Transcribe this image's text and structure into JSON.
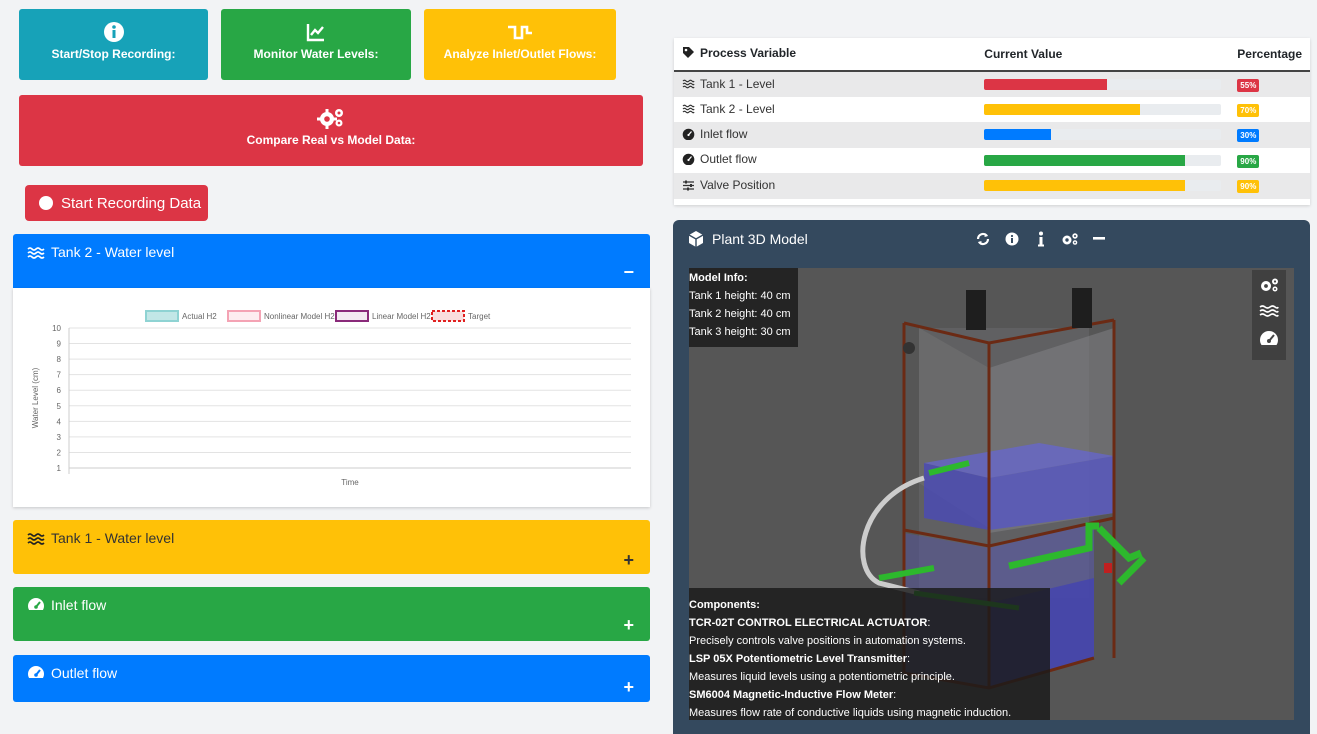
{
  "actions": {
    "start_stop": "Start/Stop Recording:",
    "monitor": "Monitor Water Levels:",
    "analyze": "Analyze Inlet/Outlet Flows:",
    "compare": "Compare Real vs Model Data:"
  },
  "record_button": "Start Recording Data",
  "panels": {
    "tank2": {
      "title": "Tank 2 - Water level",
      "toggle": "−"
    },
    "tank1": {
      "title": "Tank 1 - Water level",
      "toggle": "+"
    },
    "inlet": {
      "title": "Inlet flow",
      "toggle": "+"
    },
    "outlet": {
      "title": "Outlet flow",
      "toggle": "+"
    }
  },
  "chart_data": {
    "type": "line",
    "title": "",
    "xlabel": "Time",
    "ylabel": "Water Level (cm)",
    "ylim": [
      1,
      10
    ],
    "y_ticks": [
      "10",
      "9",
      "8",
      "7",
      "6",
      "5",
      "4",
      "3",
      "2",
      "1"
    ],
    "grid": true,
    "legend_position": "top",
    "series": [
      {
        "name": "Actual H2",
        "values": [],
        "color": "#8fd3d3"
      },
      {
        "name": "Nonlinear Model H2",
        "values": [],
        "color": "#f4a3b4"
      },
      {
        "name": "Linear Model H2",
        "values": [],
        "color": "#8a2a7a"
      },
      {
        "name": "Target",
        "values": [],
        "color": "#e02020"
      }
    ]
  },
  "process_table": {
    "headers": [
      "Process Variable",
      "Current Value",
      "Percentage"
    ],
    "rows": [
      {
        "name": "Tank 1 - Level",
        "icon": "water-icon",
        "value": 55,
        "pct": "55%",
        "color": "#dc3545"
      },
      {
        "name": "Tank 2 - Level",
        "icon": "water-icon",
        "value": 70,
        "pct": "70%",
        "color": "#ffc107"
      },
      {
        "name": "Inlet flow",
        "icon": "gauge-icon",
        "value": 30,
        "pct": "30%",
        "color": "#007bff"
      },
      {
        "name": "Outlet flow",
        "icon": "gauge-icon",
        "value": 90,
        "pct": "90%",
        "color": "#28a745"
      },
      {
        "name": "Valve Position",
        "icon": "sliders-icon",
        "value": 90,
        "pct": "90%",
        "color": "#ffc107"
      }
    ]
  },
  "model": {
    "title": "Plant 3D Model",
    "info_title": "Model Info:",
    "info_lines": [
      "Tank 1 height: 40 cm",
      "Tank 2 height: 40 cm",
      "Tank 3 height: 30 cm"
    ],
    "components_title": "Components:",
    "components": [
      {
        "name": "TCR-02T CONTROL ELECTRICAL ACTUATOR",
        "desc": "Precisely controls valve positions in automation systems."
      },
      {
        "name": "LSP 05X Potentiometric Level Transmitter",
        "desc": "Measures liquid levels using a potentiometric principle."
      },
      {
        "name": "SM6004 Magnetic-Inductive Flow Meter",
        "desc": "Measures flow rate of conductive liquids using magnetic induction."
      }
    ]
  }
}
